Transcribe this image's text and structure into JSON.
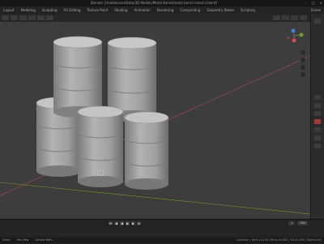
{
  "window": {
    "title": "Blender [/media/user/Data/3D Models/Metal Barrel/metal barrel (stack).blend]"
  },
  "menubar": {
    "items": [
      "Layout",
      "Modeling",
      "Sculpting",
      "UV Editing",
      "Texture Paint",
      "Shading",
      "Animation",
      "Rendering",
      "Compositing",
      "Geometry Nodes",
      "Scripting"
    ],
    "workspace": "Scene"
  },
  "status": {
    "left": [
      "Select",
      "Pan View",
      "Context Menu"
    ],
    "right": "Collection | Verts:10,148 | Faces:10,080 | Tris:20,160 | Objects:0/5"
  },
  "timeline": {
    "buttons": [
      "⏮",
      "◀",
      "◀",
      "▶",
      "▶",
      "⏭"
    ],
    "start": "1",
    "end": "250"
  },
  "colors": {
    "viewport_bg": "#3d3d3d",
    "x_axis": "#b3485c",
    "y_axis": "#6b9c2a",
    "barrel": "#a9a9a9"
  }
}
